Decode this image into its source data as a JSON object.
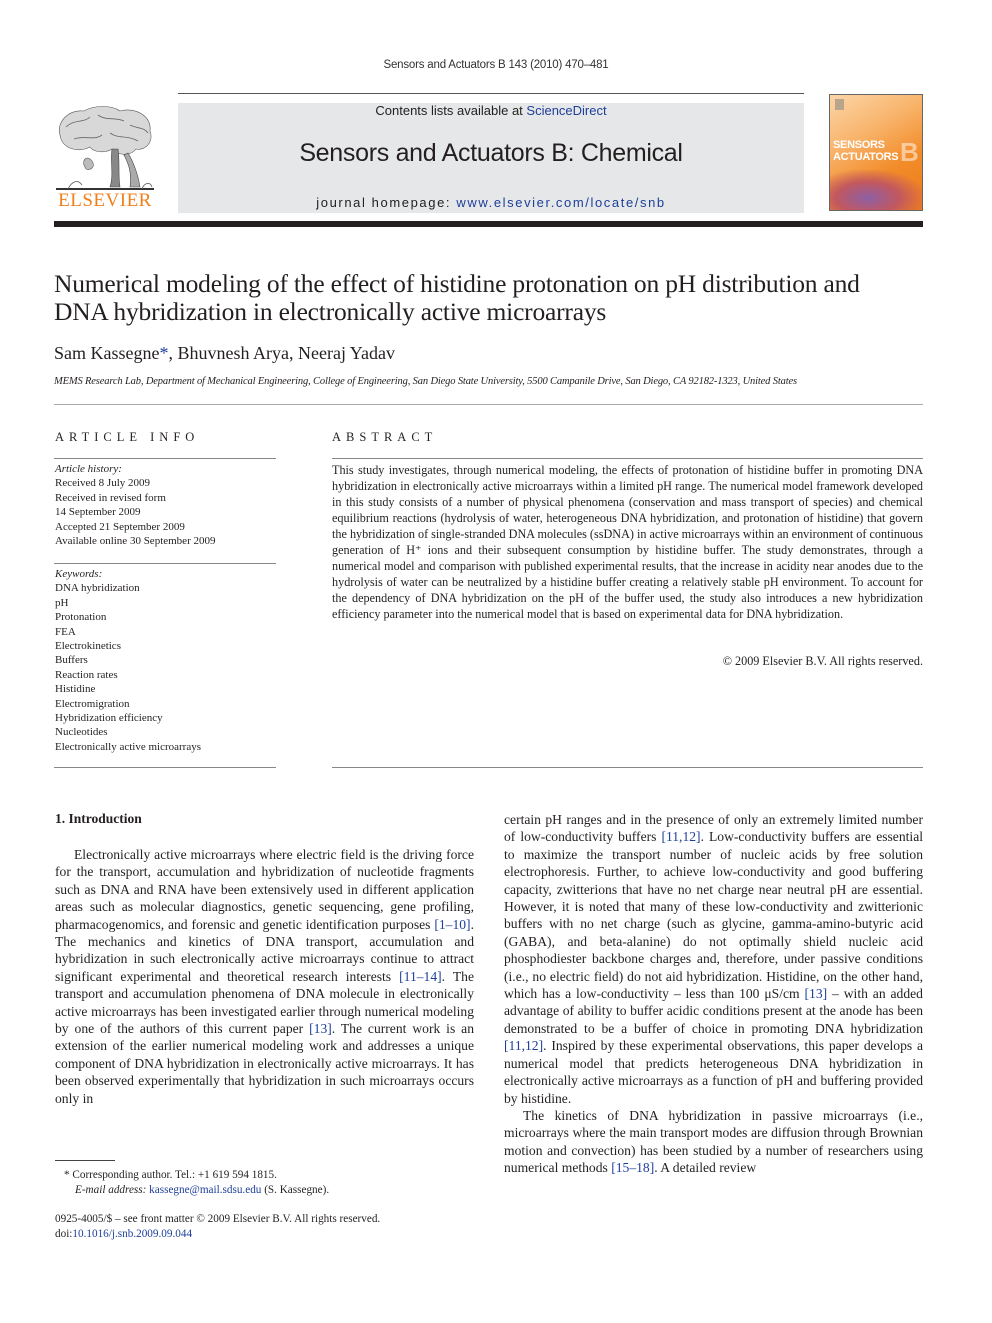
{
  "running_head": "Sensors and Actuators B 143 (2010) 470–481",
  "header": {
    "publisher_logo_text": "ELSEVIER",
    "contents_prefix": "Contents lists available at ",
    "contents_link": "ScienceDirect",
    "journal_title": "Sensors and Actuators B: Chemical",
    "homepage_prefix": "journal homepage: ",
    "homepage_link": "www.elsevier.com/locate/snb",
    "cover_title_line1": "SENSORS",
    "cover_title_line2": "ACTUATORS",
    "cover_letter": "B",
    "accent_color": "#f07f1a",
    "link_color": "#1d3f9a"
  },
  "article": {
    "title_line1": "Numerical modeling of the effect of histidine protonation on pH distribution and",
    "title_line2": "DNA hybridization in electronically active microarrays",
    "authors": [
      {
        "name": "Sam Kassegne",
        "mark": "*"
      },
      {
        "name": "Bhuvnesh Arya",
        "mark": ""
      },
      {
        "name": "Neeraj Yadav",
        "mark": ""
      }
    ],
    "affiliation": "MEMS Research Lab, Department of Mechanical Engineering, College of Engineering, San Diego State University, 5500 Campanile Drive, San Diego, CA 92182-1323, United States"
  },
  "article_info": {
    "heading": "ARTICLE INFO",
    "history_label": "Article history:",
    "history": [
      "Received 8 July 2009",
      "Received in revised form",
      "14 September 2009",
      "Accepted 21 September 2009",
      "Available online 30 September 2009"
    ],
    "keywords_label": "Keywords:",
    "keywords": [
      "DNA hybridization",
      "pH",
      "Protonation",
      "FEA",
      "Electrokinetics",
      "Buffers",
      "Reaction rates",
      "Histidine",
      "Electromigration",
      "Hybridization efficiency",
      "Nucleotides",
      "Electronically active microarrays"
    ]
  },
  "abstract": {
    "heading": "ABSTRACT",
    "text": "This study investigates, through numerical modeling, the effects of protonation of histidine buffer in promoting DNA hybridization in electronically active microarrays within a limited pH range. The numerical model framework developed in this study consists of a number of physical phenomena (conservation and mass transport of species) and chemical equilibrium reactions (hydrolysis of water, heterogeneous DNA hybridization, and protonation of histidine) that govern the hybridization of single-stranded DNA molecules (ssDNA) in active microarrays within an environment of continuous generation of H⁺ ions and their subsequent consumption by histidine buffer. The study demonstrates, through a numerical model and comparison with published experimental results, that the increase in acidity near anodes due to the hydrolysis of water can be neutralized by a histidine buffer creating a relatively stable pH environment. To account for the dependency of DNA hybridization on the pH of the buffer used, the study also introduces a new hybridization efficiency parameter into the numerical model that is based on experimental data for DNA hybridization.",
    "copyright": "© 2009 Elsevier B.V. All rights reserved."
  },
  "body": {
    "section_heading": "1.  Introduction",
    "left_col": [
      {
        "t": "Electronically active microarrays where electric field is the driving force for the transport, accumulation and hybridization of nucleotide fragments such as DNA and RNA have been extensively used in different application areas such as molecular diagnostics, genetic sequencing, gene profiling, pharmacogenomics, and forensic and genetic identification purposes "
      },
      {
        "ref": "[1–10]"
      },
      {
        "t": ". The mechanics and kinetics of DNA transport, accumulation and hybridization in such electronically active microarrays continue to attract significant experimental and theoretical research interests "
      },
      {
        "ref": "[11–14]"
      },
      {
        "t": ". The transport and accumulation phenomena of DNA molecule in electronically active microarrays has been investigated earlier through numerical modeling by one of the authors of this current paper "
      },
      {
        "ref": "[13]"
      },
      {
        "t": ". The current work is an extension of the earlier numerical modeling work and addresses a unique component of DNA hybridization in electronically active microarrays. It has been observed experimentally that hybridization in such microarrays occurs only in"
      }
    ],
    "right_col_p1": [
      {
        "t": "certain pH ranges and in the presence of only an extremely limited number of low-conductivity buffers "
      },
      {
        "ref": "[11,12]"
      },
      {
        "t": ". Low-conductivity buffers are essential to maximize the transport number of nucleic acids by free solution electrophoresis. Further, to achieve low-conductivity and good buffering capacity, zwitterions that have no net charge near neutral pH are essential. However, it is noted that many of these low-conductivity and zwitterionic buffers with no net charge (such as glycine, gamma-amino-butyric acid (GABA), and beta-alanine) do not optimally shield nucleic acid phosphodiester backbone charges and, therefore, under passive conditions (i.e., no electric field) do not aid hybridization. Histidine, on the other hand, which has a low-conductivity – less than 100 μS/cm "
      },
      {
        "ref": "[13]"
      },
      {
        "t": " – with an added advantage of ability to buffer acidic conditions present at the anode has been demonstrated to be a buffer of choice in promoting DNA hybridization "
      },
      {
        "ref": "[11,12]"
      },
      {
        "t": ". Inspired by these experimental observations, this paper develops a numerical model that predicts heterogeneous DNA hybridization in electronically active microarrays as a function of pH and buffering provided by histidine."
      }
    ],
    "right_col_p2": [
      {
        "t": "The kinetics of DNA hybridization in passive microarrays (i.e., microarrays where the main transport modes are diffusion through Brownian motion and convection) has been studied by a number of researchers using numerical methods "
      },
      {
        "ref": "[15–18]"
      },
      {
        "t": ". A detailed review"
      }
    ]
  },
  "footnotes": {
    "corresponding": "*  Corresponding author. Tel.: +1 619 594 1815.",
    "email_label": "E-mail address: ",
    "email": "kassegne@mail.sdsu.edu",
    "email_suffix": " (S. Kassegne).",
    "issn_line": "0925-4005/$ – see front matter © 2009 Elsevier B.V. All rights reserved.",
    "doi_prefix": "doi:",
    "doi": "10.1016/j.snb.2009.09.044"
  }
}
